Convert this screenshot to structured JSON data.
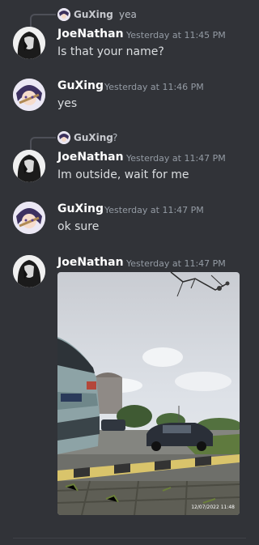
{
  "messages": [
    {
      "reply_author": "GuXing",
      "reply_text": "yea",
      "author": "JoeNathan",
      "timestamp": "Yesterday at 11:45 PM",
      "text": "Is that your name?"
    },
    {
      "author": "GuXing",
      "timestamp": "Yesterday at 11:46 PM",
      "text": "yes"
    },
    {
      "reply_author": "GuXing",
      "reply_text": "?",
      "author": "JoeNathan",
      "timestamp": "Yesterday at 11:47 PM",
      "text": "Im outside, wait for me"
    },
    {
      "author": "GuXing",
      "timestamp": "Yesterday at 11:47 PM",
      "text": "ok sure"
    },
    {
      "author": "JoeNathan",
      "timestamp": "Yesterday at 11:47 PM",
      "photo_stamp": "12/07/2022 11:48"
    }
  ]
}
